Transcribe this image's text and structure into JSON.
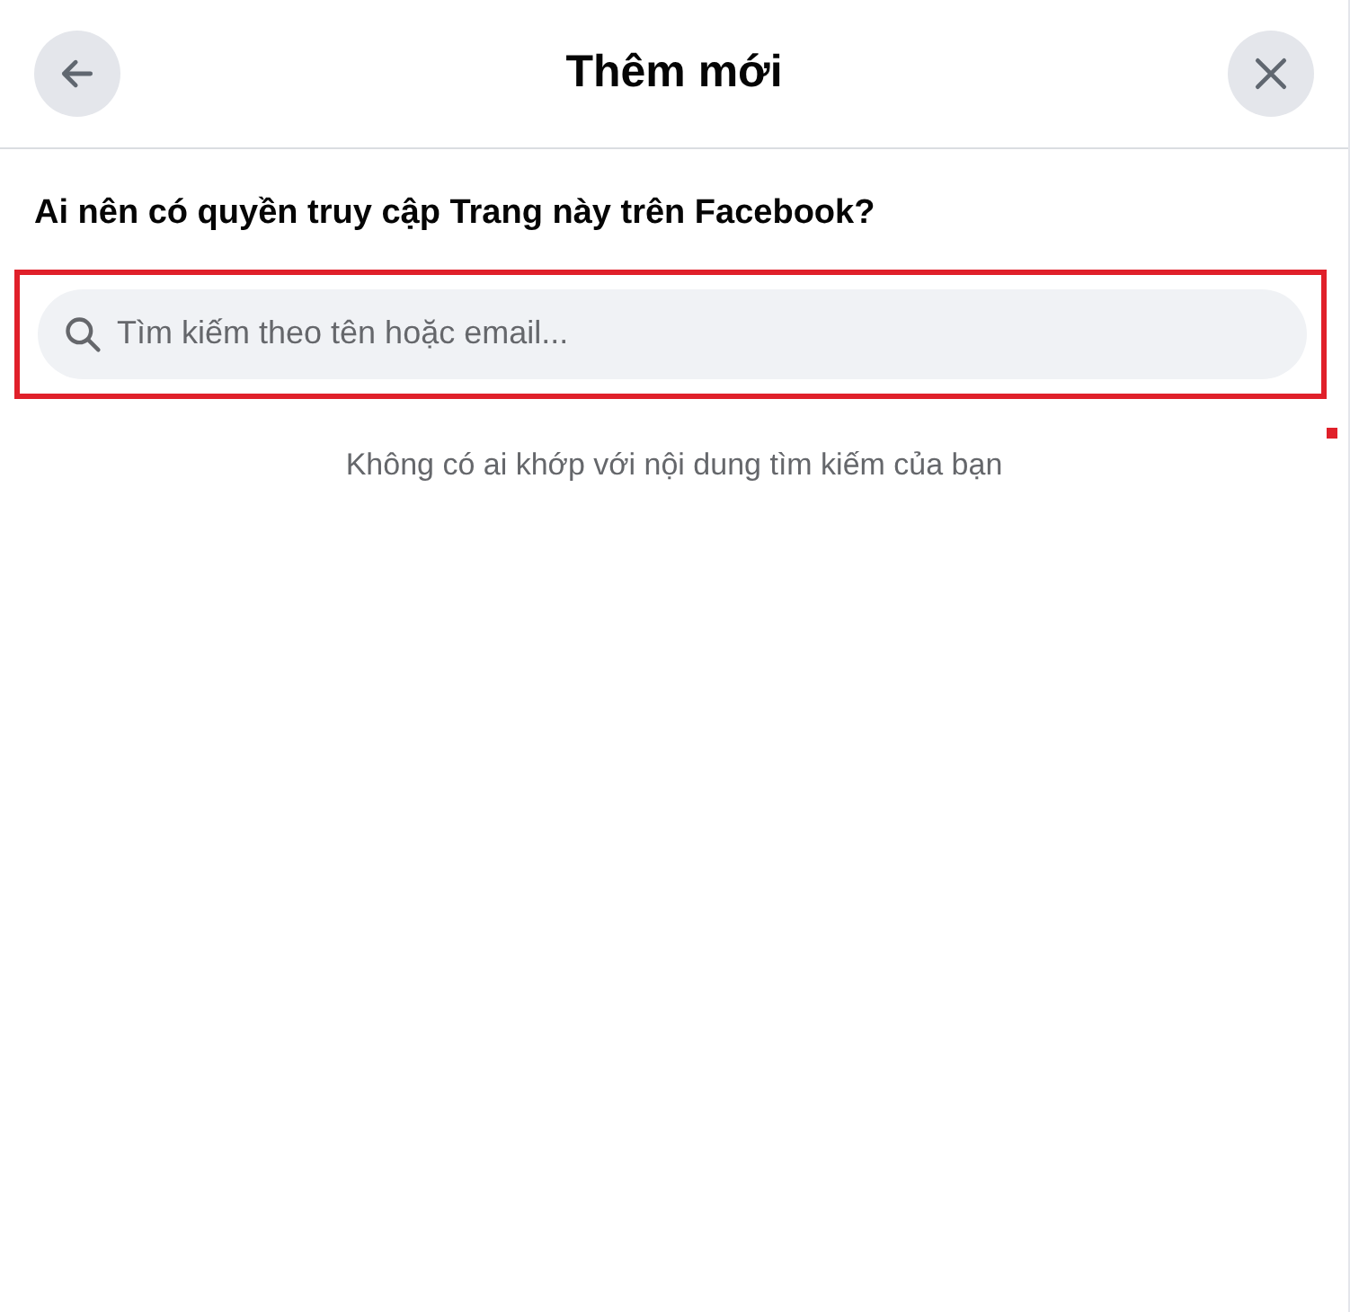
{
  "header": {
    "title": "Thêm mới"
  },
  "question": "Ai nên có quyền truy cập Trang này trên Facebook?",
  "search": {
    "placeholder": "Tìm kiếm theo tên hoặc email...",
    "highlighted": true
  },
  "empty_message": "Không có ai khớp với nội dung tìm kiếm của bạn"
}
